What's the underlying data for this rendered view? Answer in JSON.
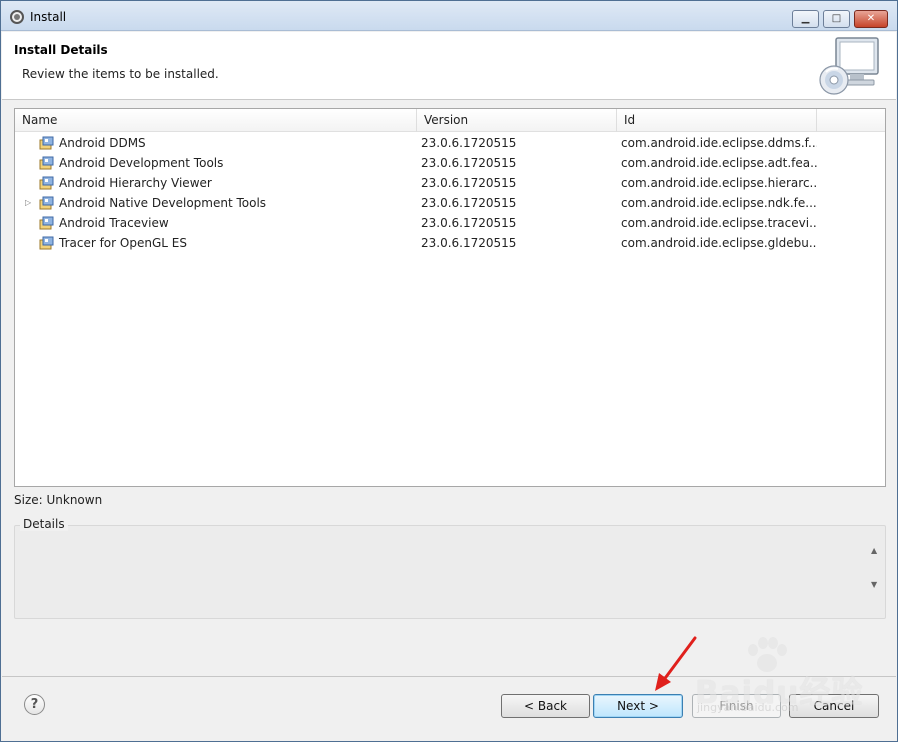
{
  "window": {
    "title": "Install",
    "minimize_label": "▁",
    "maximize_label": "□",
    "close_label": "✕"
  },
  "header": {
    "title": "Install Details",
    "subtitle": "Review the items to be installed."
  },
  "table": {
    "columns": [
      "Name",
      "Version",
      "Id"
    ],
    "rows": [
      {
        "name": "Android DDMS",
        "version": "23.0.6.1720515",
        "id": "com.android.ide.eclipse.ddms.f...",
        "expandable": false
      },
      {
        "name": "Android Development Tools",
        "version": "23.0.6.1720515",
        "id": "com.android.ide.eclipse.adt.fea...",
        "expandable": false
      },
      {
        "name": "Android Hierarchy Viewer",
        "version": "23.0.6.1720515",
        "id": "com.android.ide.eclipse.hierarc...",
        "expandable": false
      },
      {
        "name": "Android Native Development Tools",
        "version": "23.0.6.1720515",
        "id": "com.android.ide.eclipse.ndk.fe...",
        "expandable": true
      },
      {
        "name": "Android Traceview",
        "version": "23.0.6.1720515",
        "id": "com.android.ide.eclipse.tracevi...",
        "expandable": false
      },
      {
        "name": "Tracer for OpenGL ES",
        "version": "23.0.6.1720515",
        "id": "com.android.ide.eclipse.gldebu...",
        "expandable": false
      }
    ],
    "expander_glyph": "▷"
  },
  "size_label": "Size: Unknown",
  "details": {
    "label": "Details",
    "content": ""
  },
  "buttons": {
    "help": "?",
    "back": "< Back",
    "next": "Next >",
    "finish": "Finish",
    "cancel": "Cancel"
  },
  "watermark": {
    "text": "Baidu经验",
    "url": "jingyan.baidu.com"
  },
  "colors": {
    "annotation_arrow": "#e0201c",
    "default_button_border": "#3c7fb1"
  }
}
